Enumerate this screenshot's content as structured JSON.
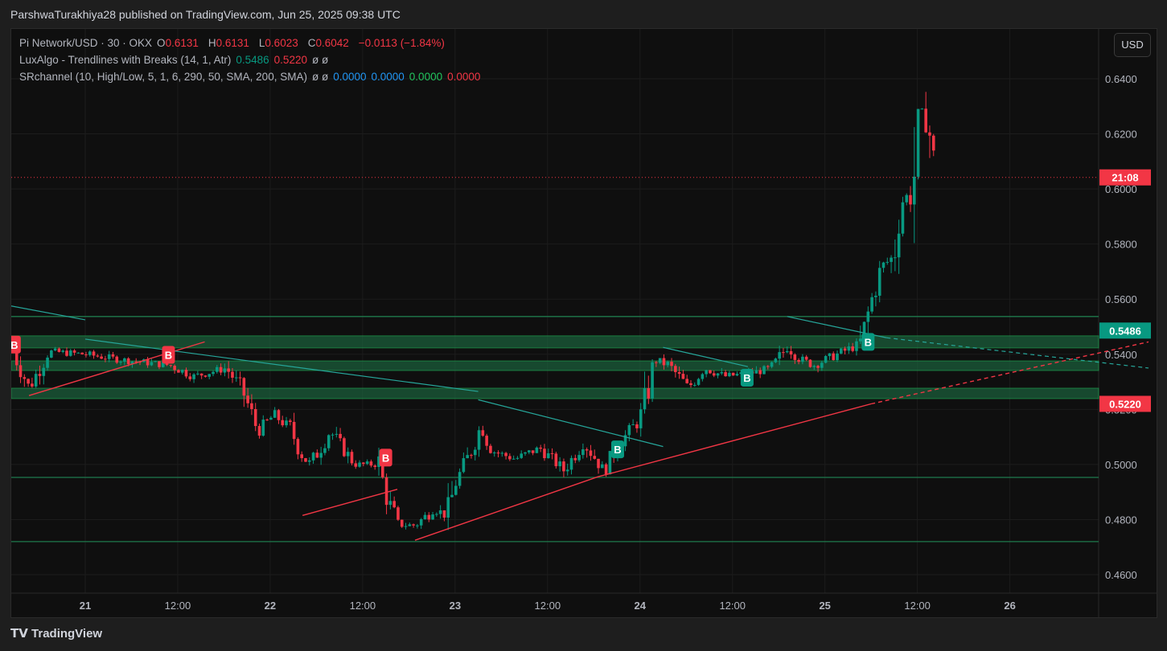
{
  "header": {
    "published": "ParshwaTurakhiya28 published on TradingView.com, Jun 25, 2025 09:38 UTC"
  },
  "legend": {
    "symbol": "Pi Network/USD · 30 · OKX",
    "o_label": "O",
    "o": "0.6131",
    "h_label": "H",
    "h": "0.6131",
    "l_label": "L",
    "l": "0.6023",
    "c_label": "C",
    "c": "0.6042",
    "change": "−0.0113 (−1.84%)",
    "ind1": "LuxAlgo - Trendlines with Breaks (14, 1, Atr)",
    "ind1_v1": "0.5486",
    "ind1_v2": "0.5220",
    "ind1_na": "ø ø",
    "ind2": "SRchannel (10, High/Low, 5, 1, 6, 290, 50, SMA, 200, SMA)",
    "ind2_na": "ø ø",
    "ind2_v1": "0.0000",
    "ind2_v2": "0.0000",
    "ind2_v3": "0.0000",
    "ind2_v4": "0.0000"
  },
  "currency": "USD",
  "footer": {
    "logo": "TradingView"
  },
  "colors": {
    "up": "#089981",
    "down": "#f23645",
    "zone": "#1b5e3b"
  },
  "chart_data": {
    "type": "candlestick",
    "interval_hours": 0.5,
    "time_unit": "hours since Jun 21 00:00",
    "ylim": [
      0.455,
      0.648
    ],
    "xlim": [
      -10.5,
      138
    ],
    "yticks": [
      "0.6400",
      "0.6200",
      "0.6000",
      "0.5800",
      "0.5600",
      "0.5400",
      "0.5200",
      "0.5000",
      "0.4800",
      "0.4600"
    ],
    "xticks": [
      {
        "t": 0,
        "label": "21"
      },
      {
        "t": 12,
        "label": "12:00"
      },
      {
        "t": 24,
        "label": "22"
      },
      {
        "t": 36,
        "label": "12:00"
      },
      {
        "t": 48,
        "label": "23"
      },
      {
        "t": 60,
        "label": "12:00"
      },
      {
        "t": 72,
        "label": "24"
      },
      {
        "t": 84,
        "label": "12:00"
      },
      {
        "t": 96,
        "label": "25"
      },
      {
        "t": 108,
        "label": "12:00"
      },
      {
        "t": 120,
        "label": "26"
      }
    ],
    "close_path": [
      [
        -9.4,
        0.541
      ],
      [
        -7.3,
        0.528
      ],
      [
        -4.7,
        0.541
      ],
      [
        0,
        0.54
      ],
      [
        4.7,
        0.538
      ],
      [
        11,
        0.536
      ],
      [
        14.1,
        0.532
      ],
      [
        18.3,
        0.535
      ],
      [
        20.4,
        0.527
      ],
      [
        22.4,
        0.512
      ],
      [
        24.5,
        0.518
      ],
      [
        26.6,
        0.513
      ],
      [
        28.2,
        0.503
      ],
      [
        29.2,
        0.5
      ],
      [
        31.8,
        0.512
      ],
      [
        35,
        0.5
      ],
      [
        38.1,
        0.5
      ],
      [
        39.1,
        0.488
      ],
      [
        40.7,
        0.478
      ],
      [
        42.8,
        0.478
      ],
      [
        45.4,
        0.484
      ],
      [
        47,
        0.481
      ],
      [
        48,
        0.493
      ],
      [
        49.6,
        0.502
      ],
      [
        51.5,
        0.515
      ],
      [
        52.7,
        0.505
      ],
      [
        55.8,
        0.502
      ],
      [
        59,
        0.506
      ],
      [
        62.1,
        0.498
      ],
      [
        64.7,
        0.508
      ],
      [
        67.3,
        0.498
      ],
      [
        69.4,
        0.508
      ],
      [
        71.5,
        0.515
      ],
      [
        72.5,
        0.52
      ],
      [
        73.8,
        0.538
      ],
      [
        75.7,
        0.536
      ],
      [
        78.3,
        0.528
      ],
      [
        80.4,
        0.535
      ],
      [
        83,
        0.532
      ],
      [
        86.1,
        0.533
      ],
      [
        89.2,
        0.535
      ],
      [
        91.1,
        0.543
      ],
      [
        92.9,
        0.538
      ],
      [
        94.5,
        0.536
      ],
      [
        97.6,
        0.54
      ],
      [
        100.7,
        0.544
      ],
      [
        101.8,
        0.557
      ],
      [
        103.3,
        0.572
      ],
      [
        104.9,
        0.575
      ],
      [
        105.9,
        0.595
      ],
      [
        107.5,
        0.6
      ],
      [
        108,
        0.628
      ],
      [
        109.1,
        0.628
      ],
      [
        109.9,
        0.615
      ],
      [
        110.4,
        0.6042
      ]
    ],
    "sr_zones": [
      [
        0.5423,
        0.5467
      ],
      [
        0.5341,
        0.5376
      ],
      [
        0.5239,
        0.5277
      ]
    ],
    "sr_lines": [
      0.5537,
      0.4953,
      0.472
    ],
    "trendlines_up": [
      [
        [
          -7.3,
          0.525
        ],
        [
          15.5,
          0.5445
        ]
      ],
      [
        [
          28.2,
          0.4815
        ],
        [
          40.5,
          0.491
        ]
      ],
      [
        [
          42.8,
          0.4725
        ],
        [
          66.5,
          0.4955
        ],
        [
          102,
          0.522
        ]
      ],
      [
        [
          102,
          0.522
        ],
        [
          138,
          0.5445
        ]
      ]
    ],
    "trendlines_down": [
      [
        [
          -10.5,
          0.558
        ],
        [
          0,
          0.5525
        ]
      ],
      [
        [
          0,
          0.5455
        ],
        [
          51,
          0.5265
        ]
      ],
      [
        [
          51,
          0.5235
        ],
        [
          75,
          0.5065
        ]
      ],
      [
        [
          75,
          0.5425
        ],
        [
          86,
          0.5355
        ]
      ],
      [
        [
          91.1,
          0.5537
        ],
        [
          104,
          0.546
        ]
      ],
      [
        [
          104,
          0.546
        ],
        [
          138,
          0.535
        ]
      ]
    ],
    "breaks": [
      {
        "t": -9.2,
        "p": 0.5435,
        "label": "B",
        "dir": "down"
      },
      {
        "t": 10.8,
        "p": 0.5398,
        "label": "B",
        "dir": "down"
      },
      {
        "t": 39,
        "p": 0.5025,
        "label": "B",
        "dir": "down"
      },
      {
        "t": 69.1,
        "p": 0.5055,
        "label": "B",
        "dir": "up"
      },
      {
        "t": 85.9,
        "p": 0.5315,
        "label": "B",
        "dir": "up"
      },
      {
        "t": 101.6,
        "p": 0.5445,
        "label": "B",
        "dir": "up"
      }
    ],
    "price_labels": [
      {
        "text": "21:08",
        "p": 0.6042,
        "color": "#f23645"
      },
      {
        "text": "0.5486",
        "p": 0.5486,
        "color": "#089981"
      },
      {
        "text": "0.5220",
        "p": 0.522,
        "color": "#f23645"
      }
    ]
  }
}
